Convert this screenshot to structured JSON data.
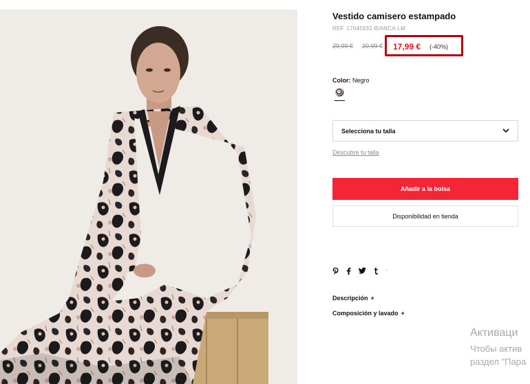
{
  "product": {
    "title": "Vestido camisero estampado",
    "ref": "REF. 17045932-BIANCA-LM",
    "old_prices": [
      "29,99 €",
      "20,99 €"
    ],
    "price": "17,99 €",
    "discount": "(-40%)",
    "color_label": "Color:",
    "color_value": "Negro",
    "image_alt": "Model wearing printed shirt dress"
  },
  "size": {
    "placeholder": "Selecciona tu talla",
    "guide_link": "Descubre tu talla"
  },
  "actions": {
    "add_to_bag": "Añadir a la bolsa",
    "store_availability": "Disponibilidad en tienda"
  },
  "social": {
    "icons": [
      "pinterest-icon",
      "facebook-icon",
      "twitter-icon",
      "tumblr-icon"
    ],
    "glyphs": [
      "𝗽",
      "f",
      "𝘄",
      "t",
      "'"
    ]
  },
  "sections": [
    {
      "label": "Descripción",
      "toggle": "+"
    },
    {
      "label": "Composición y lavado",
      "toggle": "+"
    }
  ],
  "watermark": {
    "line1": "Активаци",
    "line2": "Чтобы актив",
    "line3": "раздел \"Пара"
  },
  "colors": {
    "accent_red": "#f42536",
    "price_red": "#e1141e",
    "highlight_box": "#b4000c"
  }
}
